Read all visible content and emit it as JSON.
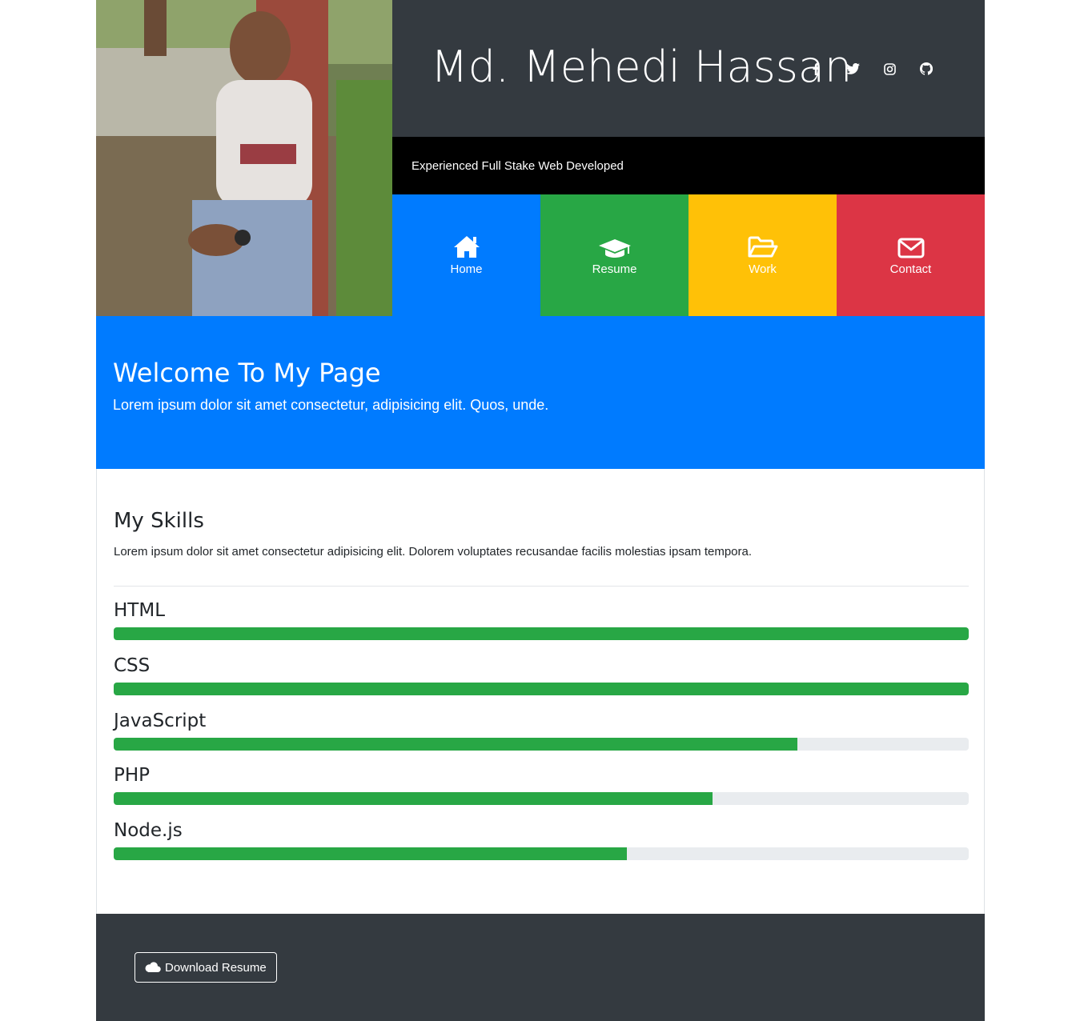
{
  "header": {
    "name": "Md. Mehedi Hassan",
    "tagline": "Experienced Full Stake Web Developed",
    "socials": [
      {
        "icon": "facebook-icon"
      },
      {
        "icon": "twitter-icon"
      },
      {
        "icon": "instagram-icon"
      },
      {
        "icon": "github-icon"
      }
    ]
  },
  "nav": [
    {
      "label": "Home",
      "icon": "home-icon",
      "color": "#007bff"
    },
    {
      "label": "Resume",
      "icon": "graduation-cap-icon",
      "color": "#28a745"
    },
    {
      "label": "Work",
      "icon": "folder-open-icon",
      "color": "#ffc107"
    },
    {
      "label": "Contact",
      "icon": "envelope-icon",
      "color": "#dc3545"
    }
  ],
  "welcome": {
    "title": "Welcome To My Page",
    "text": "Lorem ipsum dolor sit amet consectetur, adipisicing elit. Quos, unde."
  },
  "skills": {
    "title": "My Skills",
    "text": "Lorem ipsum dolor sit amet consectetur adipisicing elit. Dolorem voluptates recusandae facilis molestias ipsam tempora.",
    "items": [
      {
        "name": "HTML",
        "percent": 100
      },
      {
        "name": "CSS",
        "percent": 100
      },
      {
        "name": "JavaScript",
        "percent": 80
      },
      {
        "name": "PHP",
        "percent": 70
      },
      {
        "name": "Node.js",
        "percent": 60
      }
    ]
  },
  "footer": {
    "download_label": "Download Resume",
    "download_icon": "cloud-icon"
  },
  "colors": {
    "primary": "#007bff",
    "success": "#28a745",
    "warning": "#ffc107",
    "danger": "#dc3545",
    "dark": "#343a40"
  }
}
